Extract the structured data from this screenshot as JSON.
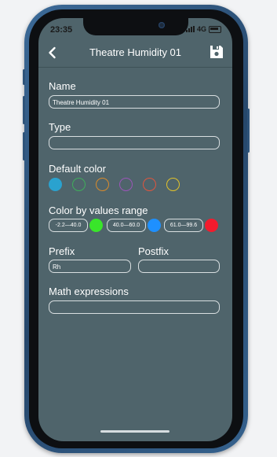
{
  "status": {
    "time": "23:35",
    "network": "4G"
  },
  "header": {
    "title": "Theatre Humidity 01"
  },
  "form": {
    "name_label": "Name",
    "name_value": "Theatre Humidity 01",
    "type_label": "Type",
    "type_value": "",
    "default_color_label": "Default color",
    "default_colors": [
      "#2aa2cf",
      "#3fae5b",
      "#d98b2b",
      "#9b55b8",
      "#e0553e",
      "#e2c22a"
    ],
    "range_label": "Color by values range",
    "ranges": [
      {
        "text": "-2.2—40.0",
        "color": "#39e52a"
      },
      {
        "text": "40.0—60.0",
        "color": "#1e90ff"
      },
      {
        "text": "61.0—99.6",
        "color": "#f21b2d"
      }
    ],
    "prefix_label": "Prefix",
    "prefix_value": "Rh",
    "postfix_label": "Postfix",
    "postfix_value": "",
    "math_label": "Math expressions",
    "math_value": ""
  },
  "colors": {
    "screen_bg": "#4f646b",
    "text": "#ffffff"
  }
}
